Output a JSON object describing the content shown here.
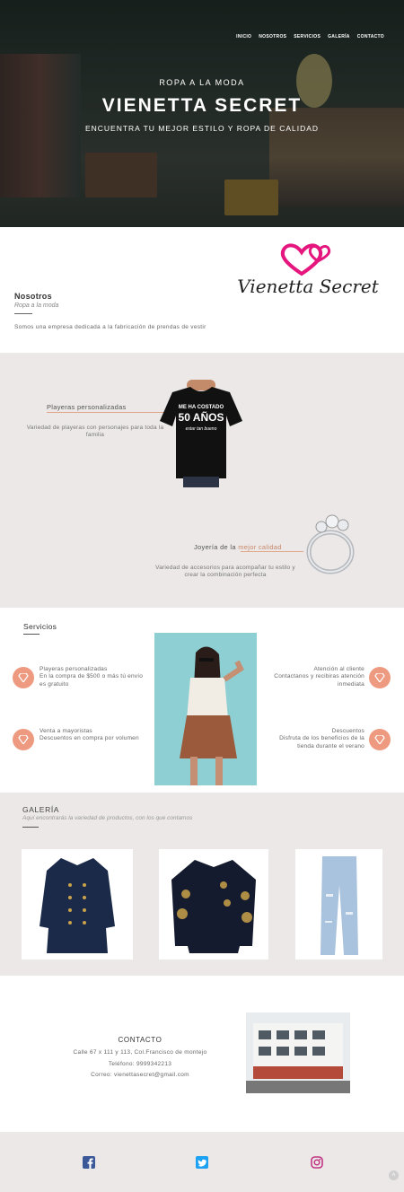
{
  "nav": {
    "items": [
      "INICIO",
      "NOSOTROS",
      "SERVICIOS",
      "GALERÍA",
      "CONTACTO"
    ]
  },
  "hero": {
    "subtitle": "ROPA A LA MODA",
    "title": "VIENETTA SECRET",
    "tagline": "ENCUENTRA TU MEJOR ESTILO Y ROPA DE CALIDAD"
  },
  "about": {
    "heading": "Nosotros",
    "subheading": "Ropa a la moda",
    "text": "Somos una empresa dedicada a la fabricación de prendas de vestir",
    "logo_text": "Vienetta Secret"
  },
  "products": {
    "item1": {
      "title": "Playeras personalizadas",
      "description": "Variedad de playeras con personajes para toda la familia",
      "shirt_print": [
        "ME HA COSTADO",
        "50 AÑOS",
        "estar tan bueno"
      ]
    },
    "item2": {
      "title_prefix": "Joyería de la ",
      "title_highlight": "mejor calidad",
      "description": "Variedad de accesorios para acompañar tu estilo y crear la combinación perfecta"
    }
  },
  "services": {
    "heading": "Servicios",
    "items": [
      {
        "title": "Playeras personalizadas",
        "text": "En la compra de $500 o más tú envío es gratuito"
      },
      {
        "title": "Venta a mayoristas",
        "text": "Descuentos en compra por volumen"
      },
      {
        "title": "Atención al cliente",
        "text": "Contactanos y recibiras atención inmediata"
      },
      {
        "title": "Descuentos",
        "text": "Disfruta de los beneficios de la tienda durante el verano"
      }
    ]
  },
  "gallery": {
    "heading": "GALERÍA",
    "subheading": "Aquí encontrarás la variedad de productos, con los que contamos"
  },
  "contact": {
    "heading": "CONTACTO",
    "address": "Calle 67 x 111 y 113, Col.Francisco de montejo",
    "phone": "Teléfono: 9999342213",
    "email": "Correo: vienettasecret@gmail.com"
  },
  "colors": {
    "accent": "#ee9a80",
    "grey_bg": "#ebe8e7",
    "facebook": "#3b5998",
    "twitter": "#1da1f2",
    "instagram": "#c13584"
  }
}
